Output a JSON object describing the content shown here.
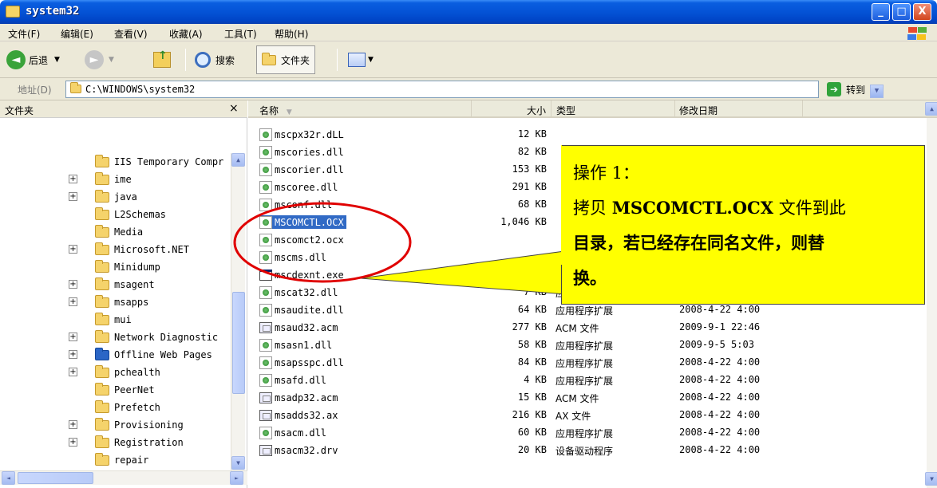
{
  "window": {
    "title": "system32",
    "min_label": "_",
    "max_label": "□",
    "close_label": "X"
  },
  "menu": [
    "文件(F)",
    "编辑(E)",
    "查看(V)",
    "收藏(A)",
    "工具(T)",
    "帮助(H)"
  ],
  "toolbar": {
    "back_label": "后退",
    "search_label": "搜索",
    "folders_label": "文件夹"
  },
  "address": {
    "label": "地址(D)",
    "path": "C:\\WINDOWS\\system32",
    "go_label": "转到"
  },
  "folder_pane": {
    "header": "文件夹",
    "close": "×",
    "items": [
      {
        "label": "IIS Temporary Compr",
        "expandable": false
      },
      {
        "label": "ime",
        "expandable": true
      },
      {
        "label": "java",
        "expandable": true
      },
      {
        "label": "L2Schemas",
        "expandable": false
      },
      {
        "label": "Media",
        "expandable": false
      },
      {
        "label": "Microsoft.NET",
        "expandable": true
      },
      {
        "label": "Minidump",
        "expandable": false
      },
      {
        "label": "msagent",
        "expandable": true
      },
      {
        "label": "msapps",
        "expandable": true
      },
      {
        "label": "mui",
        "expandable": false
      },
      {
        "label": "Network Diagnostic",
        "expandable": true
      },
      {
        "label": "Offline Web Pages",
        "expandable": true
      },
      {
        "label": "pchealth",
        "expandable": true
      },
      {
        "label": "PeerNet",
        "expandable": false
      },
      {
        "label": "Prefetch",
        "expandable": false
      },
      {
        "label": "Provisioning",
        "expandable": true
      },
      {
        "label": "Registration",
        "expandable": true
      },
      {
        "label": "repair",
        "expandable": false
      }
    ]
  },
  "file_list": {
    "columns": {
      "name": "名称",
      "size": "大小",
      "type": "类型",
      "date": "修改日期"
    },
    "rows": [
      {
        "name": "mscpx32r.dLL",
        "size": "12 KB",
        "type": "",
        "date": "",
        "icon": "dll"
      },
      {
        "name": "mscories.dll",
        "size": "82 KB",
        "type": "",
        "date": "",
        "icon": "dll"
      },
      {
        "name": "mscorier.dll",
        "size": "153 KB",
        "type": "",
        "date": "",
        "icon": "dll"
      },
      {
        "name": "mscoree.dll",
        "size": "291 KB",
        "type": "",
        "date": "",
        "icon": "dll"
      },
      {
        "name": "msconf.dll",
        "size": "68 KB",
        "type": "",
        "date": "",
        "icon": "dll"
      },
      {
        "name": "MSCOMCTL.OCX",
        "size": "1,046 KB",
        "type": "",
        "date": "",
        "icon": "dll",
        "selected": true
      },
      {
        "name": "mscomct2.ocx",
        "size": "",
        "type": "",
        "date": "",
        "icon": "dll"
      },
      {
        "name": "mscms.dll",
        "size": "",
        "type": "",
        "date": "",
        "icon": "dll"
      },
      {
        "name": "mscdexnt.exe",
        "size": "1 KB",
        "type": "",
        "date": "",
        "icon": "exe"
      },
      {
        "name": "mscat32.dll",
        "size": "7 KB",
        "type": "应用程序扩展",
        "date": "2008-4-22 4:00",
        "icon": "dll"
      },
      {
        "name": "msaudite.dll",
        "size": "64 KB",
        "type": "应用程序扩展",
        "date": "2008-4-22 4:00",
        "icon": "dll"
      },
      {
        "name": "msaud32.acm",
        "size": "277 KB",
        "type": "ACM 文件",
        "date": "2009-9-1 22:46",
        "icon": "acm"
      },
      {
        "name": "msasn1.dll",
        "size": "58 KB",
        "type": "应用程序扩展",
        "date": "2009-9-5 5:03",
        "icon": "dll"
      },
      {
        "name": "msapsspc.dll",
        "size": "84 KB",
        "type": "应用程序扩展",
        "date": "2008-4-22 4:00",
        "icon": "dll"
      },
      {
        "name": "msafd.dll",
        "size": "4 KB",
        "type": "应用程序扩展",
        "date": "2008-4-22 4:00",
        "icon": "dll"
      },
      {
        "name": "msadp32.acm",
        "size": "15 KB",
        "type": "ACM 文件",
        "date": "2008-4-22 4:00",
        "icon": "acm"
      },
      {
        "name": "msadds32.ax",
        "size": "216 KB",
        "type": "AX 文件",
        "date": "2008-4-22 4:00",
        "icon": "acm"
      },
      {
        "name": "msacm.dll",
        "size": "60 KB",
        "type": "应用程序扩展",
        "date": "2008-4-22 4:00",
        "icon": "dll"
      },
      {
        "name": "msacm32.drv",
        "size": "20 KB",
        "type": "设备驱动程序",
        "date": "2008-4-22 4:00",
        "icon": "acm"
      }
    ]
  },
  "callout": {
    "line1": "操作 1：",
    "line2_pre": "拷贝 ",
    "line2_bold": "MSCOMCTL.OCX",
    "line2_post": " 文件到此",
    "line3": "目录，若已经存在同名文件，则替",
    "line4": "换。"
  },
  "colors": {
    "title_blue": "#0453d6",
    "selection": "#316ac5",
    "callout_yellow": "#ffff00",
    "annotation_red": "#e00000"
  }
}
